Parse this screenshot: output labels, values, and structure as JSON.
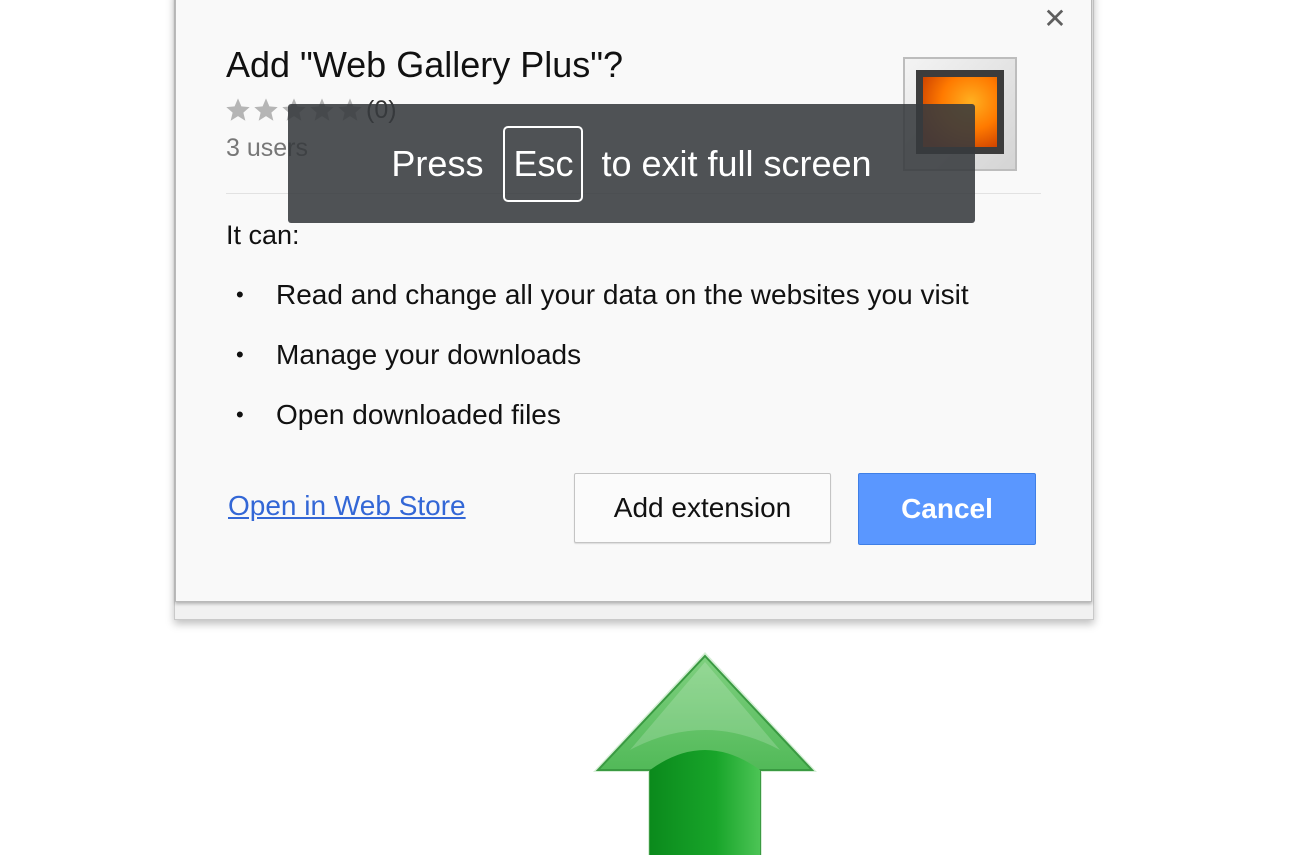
{
  "dialog": {
    "title": "Add \"Web Gallery Plus\"?",
    "rating_count": "(0)",
    "rating_stars": 0,
    "users": "3 users",
    "close_icon": "close-icon",
    "permissions_heading": "It can:",
    "permissions": [
      "Read and change all your data on the websites you visit",
      "Manage your downloads",
      "Open downloaded files"
    ],
    "webstore_link": "Open in Web Store",
    "add_button": "Add extension",
    "cancel_button": "Cancel"
  },
  "fullscreen_notice": {
    "before": "Press",
    "key": "Esc",
    "after": "to exit full screen"
  },
  "colors": {
    "primary_button": "#5a97ff",
    "link": "#3367d6",
    "overlay": "#373a3e",
    "arrow": "#22a52a"
  }
}
